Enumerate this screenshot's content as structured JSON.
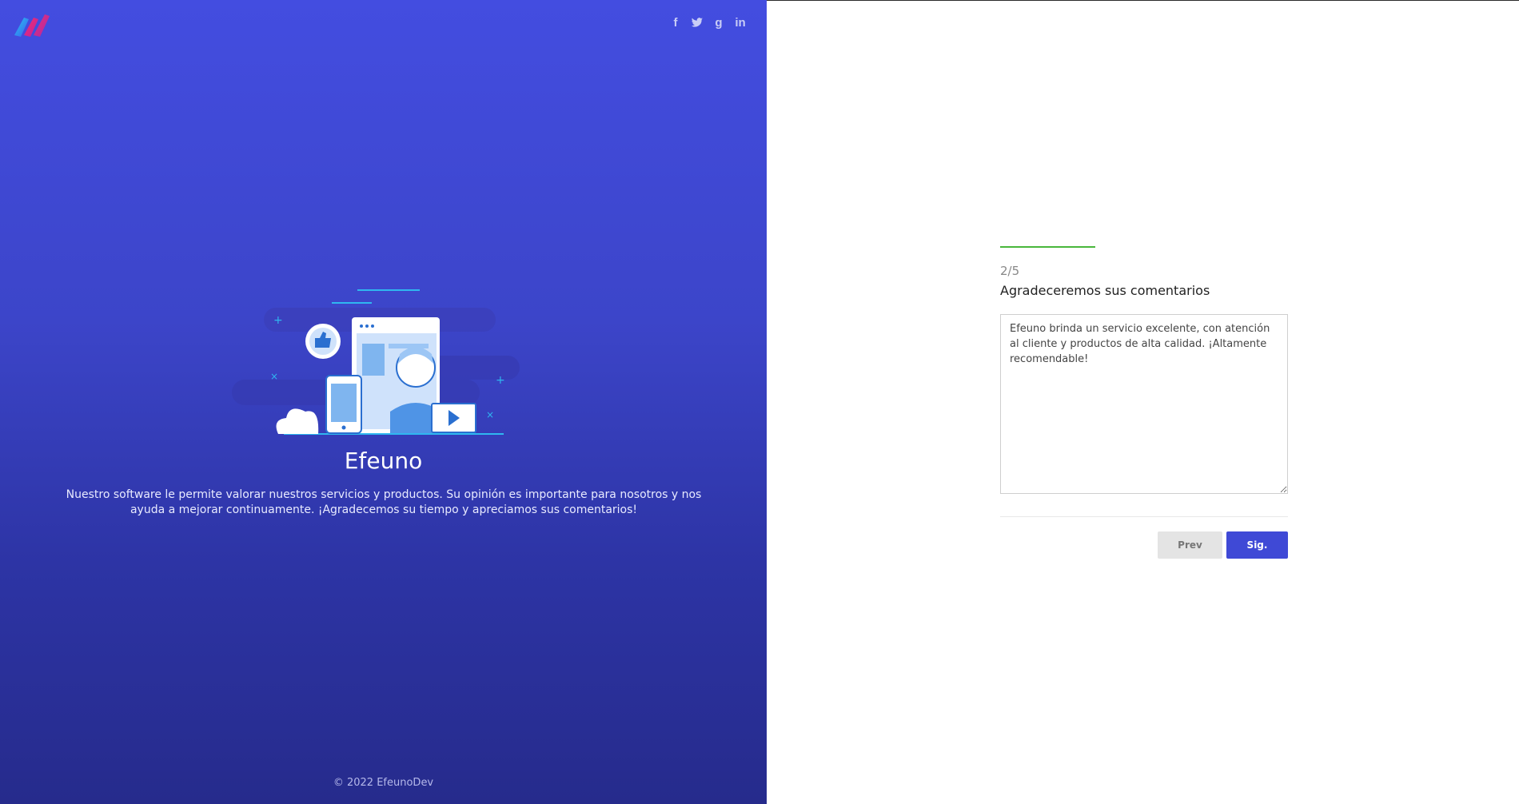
{
  "social": {
    "facebook": "f",
    "twitter": "twitter-icon",
    "google": "g",
    "linkedin": "in"
  },
  "brand": {
    "title": "Efeuno",
    "description": "Nuestro software le permite valorar nuestros servicios y productos. Su opinión es importante para nosotros y nos ayuda a mejorar continuamente. ¡Agradecemos su tiempo y apreciamos sus comentarios!",
    "footer": "© 2022 EfeunoDev"
  },
  "form": {
    "step": "2/5",
    "progress": 0.33,
    "question": "Agradeceremos sus comentarios",
    "comment_value": "Efeuno brinda un servicio excelente, con atención al cliente y productos de alta calidad. ¡Altamente recomendable!",
    "prev_label": "Prev",
    "next_label": "Sig."
  },
  "colors": {
    "accent": "#3f49d6",
    "progress": "#49b73b",
    "panel_top": "#434de0",
    "panel_bottom": "#262b8c"
  }
}
